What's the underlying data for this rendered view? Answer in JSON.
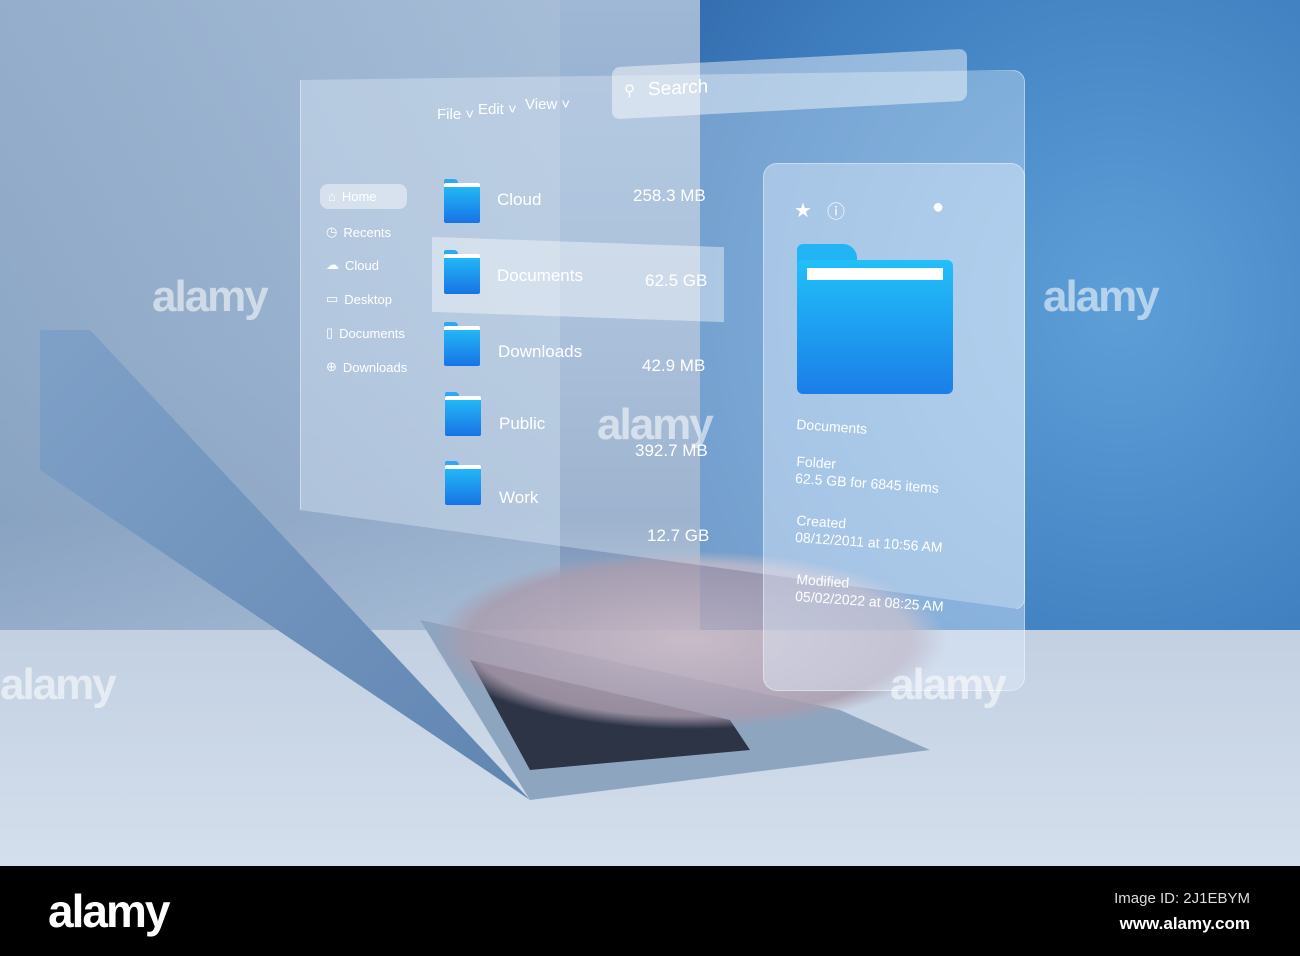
{
  "menu": {
    "file": "File",
    "edit": "Edit",
    "view": "View"
  },
  "search": {
    "placeholder": "Search"
  },
  "sidebar": {
    "items": [
      {
        "label": "Home",
        "icon": "home-icon"
      },
      {
        "label": "Recents",
        "icon": "clock-icon"
      },
      {
        "label": "Cloud",
        "icon": "cloud-icon"
      },
      {
        "label": "Desktop",
        "icon": "desktop-icon"
      },
      {
        "label": "Documents",
        "icon": "document-icon"
      },
      {
        "label": "Downloads",
        "icon": "download-icon"
      }
    ]
  },
  "files": [
    {
      "name": "Cloud",
      "size": "258.3 MB"
    },
    {
      "name": "Documents",
      "size": "62.5 GB"
    },
    {
      "name": "Downloads",
      "size": "42.9 MB"
    },
    {
      "name": "Public",
      "size": "392.7 MB"
    },
    {
      "name": "Work",
      "size": "12.7 GB"
    }
  ],
  "details": {
    "name": "Documents",
    "type_label": "Folder",
    "type_value": "62.5 GB for 6845 items",
    "created_label": "Created",
    "created_value": "08/12/2011 at 10:56 AM",
    "modified_label": "Modified",
    "modified_value": "05/02/2022 at 08:25 AM"
  },
  "watermark": {
    "text": "alamy",
    "image_id": "Image ID: 2J1EBYM",
    "url": "www.alamy.com"
  },
  "colors": {
    "folder": "#1b8ef0",
    "shirt": "#4a8ccc",
    "footer": "#000000"
  }
}
